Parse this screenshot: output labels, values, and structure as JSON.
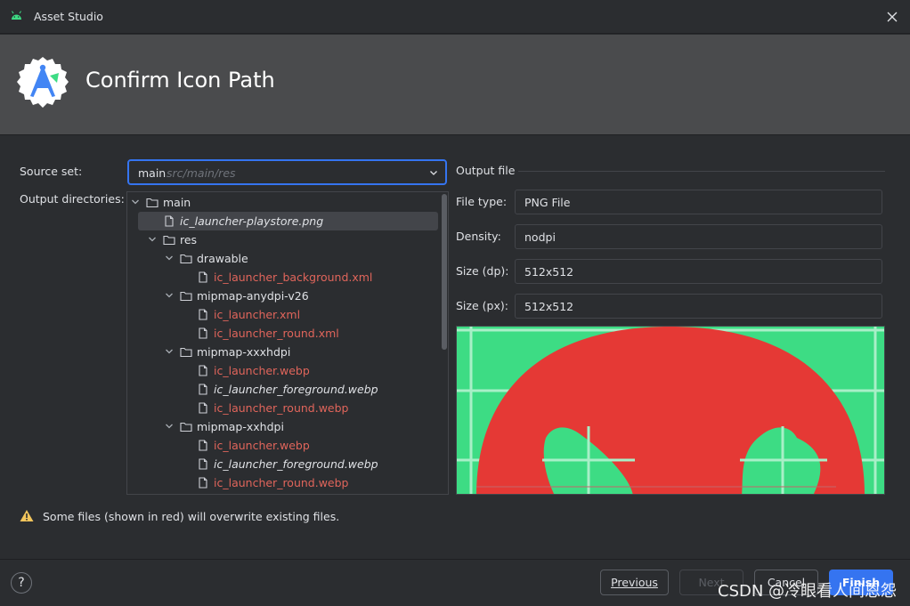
{
  "window": {
    "title": "Asset Studio",
    "heading": "Confirm Icon Path"
  },
  "form": {
    "source_set_label": "Source set:",
    "source_set_value": "main",
    "source_set_hint": "src/main/res",
    "output_dirs_label": "Output directories:"
  },
  "tree": [
    {
      "label": "main",
      "type": "folder",
      "depth": 0,
      "expanded": true,
      "red": false,
      "italic": false
    },
    {
      "label": "ic_launcher-playstore.png",
      "type": "file",
      "depth": 1,
      "red": false,
      "italic": true,
      "selected": true
    },
    {
      "label": "res",
      "type": "folder",
      "depth": 1,
      "expanded": true,
      "red": false,
      "italic": false
    },
    {
      "label": "drawable",
      "type": "folder",
      "depth": 2,
      "expanded": true,
      "red": false,
      "italic": false
    },
    {
      "label": "ic_launcher_background.xml",
      "type": "file",
      "depth": 3,
      "red": true,
      "italic": false
    },
    {
      "label": "mipmap-anydpi-v26",
      "type": "folder",
      "depth": 2,
      "expanded": true,
      "red": false,
      "italic": false
    },
    {
      "label": "ic_launcher.xml",
      "type": "file",
      "depth": 3,
      "red": true,
      "italic": false
    },
    {
      "label": "ic_launcher_round.xml",
      "type": "file",
      "depth": 3,
      "red": true,
      "italic": false
    },
    {
      "label": "mipmap-xxxhdpi",
      "type": "folder",
      "depth": 2,
      "expanded": true,
      "red": false,
      "italic": false
    },
    {
      "label": "ic_launcher.webp",
      "type": "file",
      "depth": 3,
      "red": true,
      "italic": false
    },
    {
      "label": "ic_launcher_foreground.webp",
      "type": "file",
      "depth": 3,
      "red": false,
      "italic": true
    },
    {
      "label": "ic_launcher_round.webp",
      "type": "file",
      "depth": 3,
      "red": true,
      "italic": false
    },
    {
      "label": "mipmap-xxhdpi",
      "type": "folder",
      "depth": 2,
      "expanded": true,
      "red": false,
      "italic": false
    },
    {
      "label": "ic_launcher.webp",
      "type": "file",
      "depth": 3,
      "red": true,
      "italic": false
    },
    {
      "label": "ic_launcher_foreground.webp",
      "type": "file",
      "depth": 3,
      "red": false,
      "italic": true
    },
    {
      "label": "ic_launcher_round.webp",
      "type": "file",
      "depth": 3,
      "red": true,
      "italic": false
    }
  ],
  "output_file": {
    "section_title": "Output file",
    "file_type_label": "File type:",
    "file_type_value": "PNG File",
    "density_label": "Density:",
    "density_value": "nodpi",
    "size_dp_label": "Size (dp):",
    "size_dp_value": "512x512",
    "size_px_label": "Size (px):",
    "size_px_value": "512x512"
  },
  "warning": {
    "text": "Some files (shown in red) will overwrite existing files."
  },
  "buttons": {
    "help": "?",
    "previous": "Previous",
    "next": "Next",
    "cancel": "Cancel",
    "finish": "Finish"
  },
  "watermark": "CSDN @冷眼看人间恩怨",
  "colors": {
    "accent": "#3574f0",
    "overwrite_red": "#e0655b",
    "preview_green": "#3ddc84",
    "preview_red": "#e53935"
  }
}
